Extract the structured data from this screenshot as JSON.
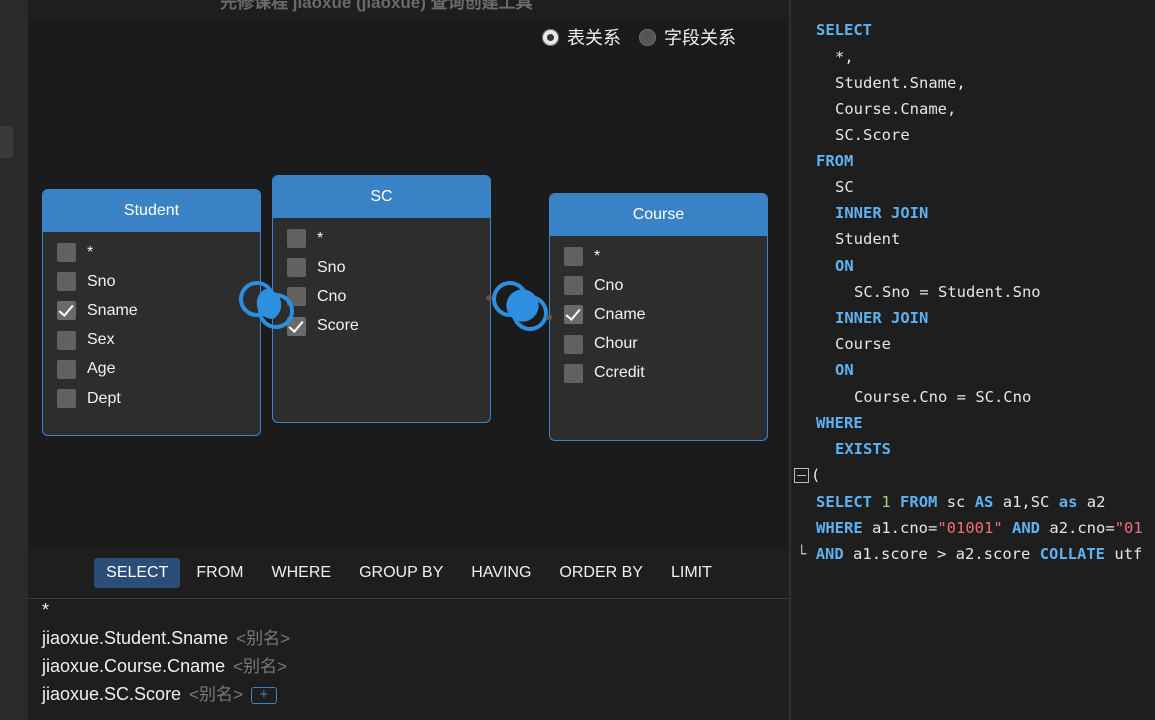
{
  "window": {
    "title_fragment": "先修课程 jiaoxue (jiaoxue) 查询创建工具"
  },
  "relation_toggle": {
    "options": [
      {
        "label": "表关系",
        "selected": true
      },
      {
        "label": "字段关系",
        "selected": false
      }
    ]
  },
  "tables": [
    {
      "name": "Student",
      "fields": [
        {
          "label": "*",
          "checked": false
        },
        {
          "label": "Sno",
          "checked": false
        },
        {
          "label": "Sname",
          "checked": true
        },
        {
          "label": "Sex",
          "checked": false
        },
        {
          "label": "Age",
          "checked": false
        },
        {
          "label": "Dept",
          "checked": false
        }
      ]
    },
    {
      "name": "SC",
      "fields": [
        {
          "label": "*",
          "checked": false
        },
        {
          "label": "Sno",
          "checked": false
        },
        {
          "label": "Cno",
          "checked": false
        },
        {
          "label": "Score",
          "checked": true
        }
      ]
    },
    {
      "name": "Course",
      "fields": [
        {
          "label": "*",
          "checked": false
        },
        {
          "label": "Cno",
          "checked": false
        },
        {
          "label": "Cname",
          "checked": true
        },
        {
          "label": "Chour",
          "checked": false
        },
        {
          "label": "Ccredit",
          "checked": false
        }
      ]
    }
  ],
  "clauses": [
    "SELECT",
    "FROM",
    "WHERE",
    "GROUP BY",
    "HAVING",
    "ORDER BY",
    "LIMIT"
  ],
  "active_clause": "SELECT",
  "select_list": {
    "star": "*",
    "items": [
      {
        "expr": "jiaoxue.Student.Sname",
        "alias_placeholder": "<别名>"
      },
      {
        "expr": "jiaoxue.Course.Cname",
        "alias_placeholder": "<别名>"
      },
      {
        "expr": "jiaoxue.SC.Score",
        "alias_placeholder": "<别名>"
      }
    ],
    "add_label": "+"
  },
  "sql": {
    "select": "SELECT",
    "col_star": "*,",
    "col_1": "Student.Sname,",
    "col_2": "Course.Cname,",
    "col_3": "SC.Score",
    "from": "FROM",
    "t_sc": "SC",
    "inner_join_1": "INNER JOIN",
    "t_student": "Student",
    "on_1": "ON",
    "cond_1": "SC.Sno = Student.Sno",
    "inner_join_2": "INNER JOIN",
    "t_course": "Course",
    "on_2": "ON",
    "cond_2": "Course.Cno = SC.Cno",
    "where": "WHERE",
    "exists": "EXISTS",
    "paren": "(",
    "sub1_kw_select": "SELECT",
    "sub1_num": "1",
    "sub1_kw_from": "FROM",
    "sub1_t1": "sc",
    "sub1_kw_as1": "AS",
    "sub1_t1_alias": "a1,SC",
    "sub1_kw_as2": "as",
    "sub1_t2_alias": "a2",
    "sub2_kw_where": "WHERE",
    "sub2_cond_a": "a1.cno=",
    "sub2_str_a": "\"01001\"",
    "sub2_kw_and": "AND",
    "sub2_cond_b": "a2.cno=",
    "sub2_str_b": "\"01",
    "sub3_prefix": "└",
    "sub3_kw_and": "AND",
    "sub3_cond": "a1.score > a2.score",
    "sub3_kw_collate": "COLLATE",
    "sub3_tail": "utf"
  }
}
